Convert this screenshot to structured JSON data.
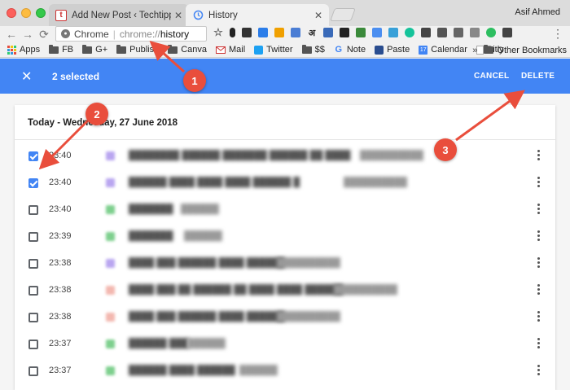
{
  "window": {
    "tabs": [
      {
        "title": "Add New Post ‹ Techtippr — W",
        "favicon": "techtippr-logo"
      },
      {
        "title": "History",
        "favicon": "history-icon"
      }
    ],
    "user": "Asif Ahmed"
  },
  "omnibox": {
    "label": "Chrome",
    "scheme": "chrome://",
    "host": "history"
  },
  "bookmarks": [
    {
      "label": "Apps",
      "icon": "apps-grid-icon"
    },
    {
      "label": "FB",
      "icon": "folder-icon"
    },
    {
      "label": "G+",
      "icon": "folder-icon"
    },
    {
      "label": "Publish",
      "icon": "folder-icon"
    },
    {
      "label": "Canva",
      "icon": "folder-icon"
    },
    {
      "label": "Mail",
      "icon": "mail-icon"
    },
    {
      "label": "Twitter",
      "icon": "twitter-icon"
    },
    {
      "label": "$$",
      "icon": "folder-icon"
    },
    {
      "label": "Note",
      "icon": "google-icon"
    },
    {
      "label": "Paste",
      "icon": "paste-icon"
    },
    {
      "label": "Calendar",
      "icon": "calendar-icon"
    },
    {
      "label": "Bitly",
      "icon": "page-icon"
    }
  ],
  "bookmarks_overflow": "»",
  "other_bookmarks": "Other Bookmarks",
  "calendar_day": "17",
  "selection": {
    "count_label": "2 selected",
    "cancel": "CANCEL",
    "delete": "DELETE"
  },
  "history": {
    "date_heading": "Today - Wednesday, 27 June 2018",
    "rows": [
      {
        "time": "23:40",
        "checked": true
      },
      {
        "time": "23:40",
        "checked": true
      },
      {
        "time": "23:40",
        "checked": false
      },
      {
        "time": "23:39",
        "checked": false
      },
      {
        "time": "23:38",
        "checked": false
      },
      {
        "time": "23:38",
        "checked": false
      },
      {
        "time": "23:38",
        "checked": false
      },
      {
        "time": "23:37",
        "checked": false
      },
      {
        "time": "23:37",
        "checked": false
      }
    ]
  },
  "annotations": [
    {
      "number": "1"
    },
    {
      "number": "2"
    },
    {
      "number": "3"
    }
  ],
  "colors": {
    "accent": "#4285f4",
    "annotation_red": "#e94e3c"
  }
}
